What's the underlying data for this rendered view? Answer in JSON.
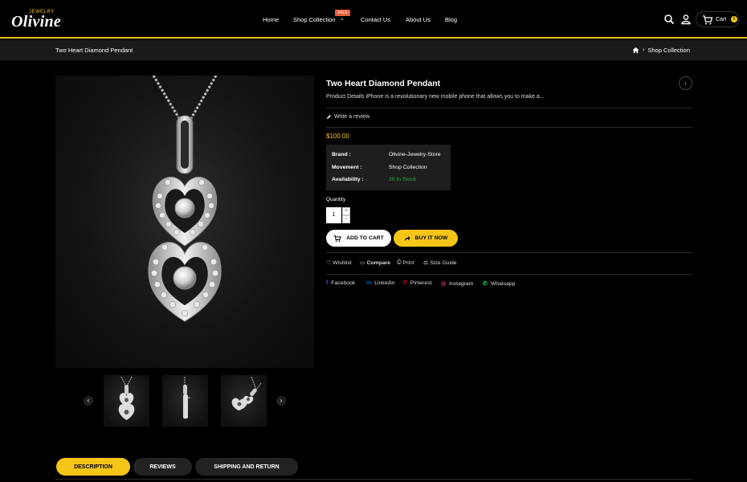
{
  "header": {
    "logo_top": "JEWELRY",
    "logo_main": "Olivine",
    "nav": [
      "Home",
      "Shop Collection",
      "Contact Us",
      "About Us",
      "Blog"
    ],
    "sale_badge": "SALE",
    "cart_label": "Cart",
    "cart_count": "0",
    "accent_color": "#f5c518"
  },
  "breadcrumb": {
    "title": "Two Heart Diamond Pendant",
    "current": "Shop Collection",
    "home_icon": "home-icon"
  },
  "product": {
    "title": "Two Heart Diamond Pendant",
    "description": "Product Details iPhone is a revolutionary new mobile phone that allows you to make a...",
    "review_link": "Write a review",
    "price": "$100.00",
    "specs": [
      {
        "key": "Brand :",
        "value": "Olivine-Jewelry-Store"
      },
      {
        "key": "Movement :",
        "value": "Shop Collection"
      },
      {
        "key": "Availability :",
        "value": "20 In Stock"
      }
    ],
    "quantity_label": "Quantity",
    "quantity": "1",
    "add_to_cart": "ADD TO CART",
    "buy_now": "BUY IT NOW",
    "stock_color": "#2fa84f"
  },
  "actions": [
    "Wishlist",
    "Compare",
    "Print",
    "Size Guide"
  ],
  "social": [
    {
      "label": "Facebook",
      "icon": "facebook-icon",
      "glyph": "f",
      "color": "#3b5998"
    },
    {
      "label": "Linkedin",
      "icon": "linkedin-icon",
      "glyph": "in",
      "color": "#0a66c2"
    },
    {
      "label": "Pinterest",
      "icon": "pinterest-icon",
      "glyph": "P",
      "color": "#e60023"
    },
    {
      "label": "Instagram",
      "icon": "instagram-icon",
      "glyph": "◎",
      "color": "#e1306c"
    },
    {
      "label": "Whatsapp",
      "icon": "whatsapp-icon",
      "glyph": "✆",
      "color": "#25d366"
    }
  ],
  "tabs": [
    "DESCRIPTION",
    "REVIEWS",
    "SHIPPING AND RETURN"
  ]
}
